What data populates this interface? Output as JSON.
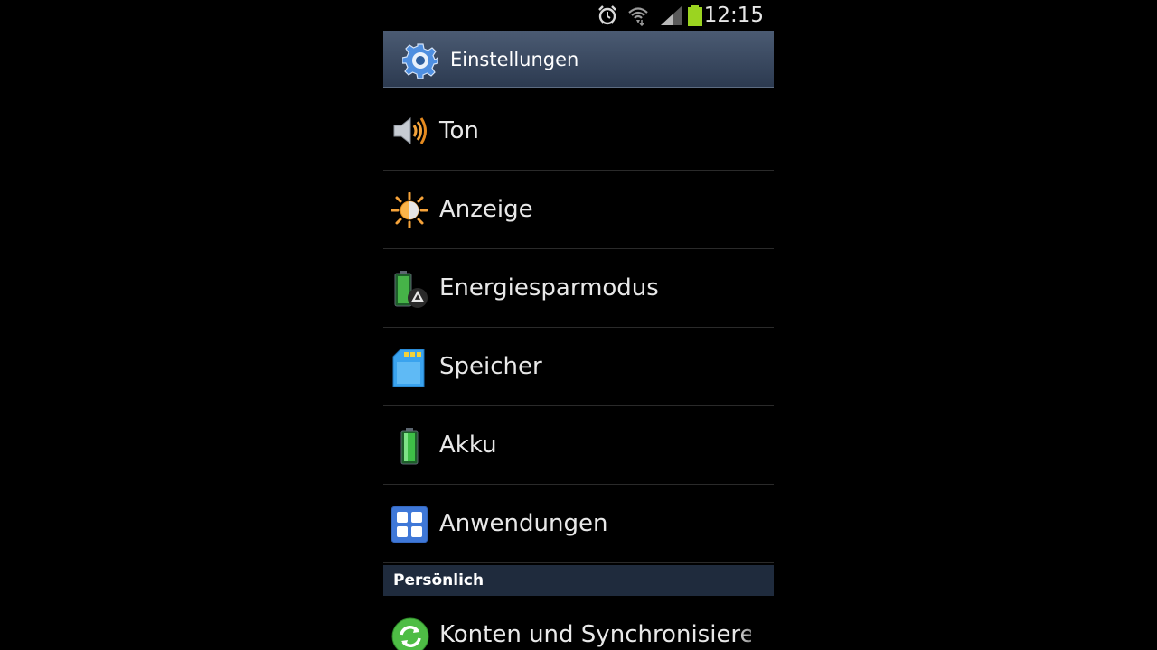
{
  "status_bar": {
    "time": "12:15",
    "icons": [
      "alarm-icon",
      "wifi-icon",
      "signal-icon",
      "battery-icon"
    ],
    "battery_color": "#9bd420"
  },
  "title_bar": {
    "title": "Einstellungen",
    "icon": "gear-icon"
  },
  "settings": {
    "items": [
      {
        "label": "Ton",
        "icon": "speaker-icon"
      },
      {
        "label": "Anzeige",
        "icon": "sun-icon"
      },
      {
        "label": "Energiesparmodus",
        "icon": "battery-recycle-icon"
      },
      {
        "label": "Speicher",
        "icon": "sd-card-icon"
      },
      {
        "label": "Akku",
        "icon": "battery-icon"
      },
      {
        "label": "Anwendungen",
        "icon": "apps-grid-icon"
      }
    ],
    "section_header": "Persönlich",
    "partial_item": {
      "label": "Konten und Synchronisieren",
      "icon": "sync-icon"
    }
  },
  "colors": {
    "background": "#000000",
    "title_bar": "#3b4a60",
    "section_header": "#1f2b3d",
    "text": "#e8e8e8"
  }
}
